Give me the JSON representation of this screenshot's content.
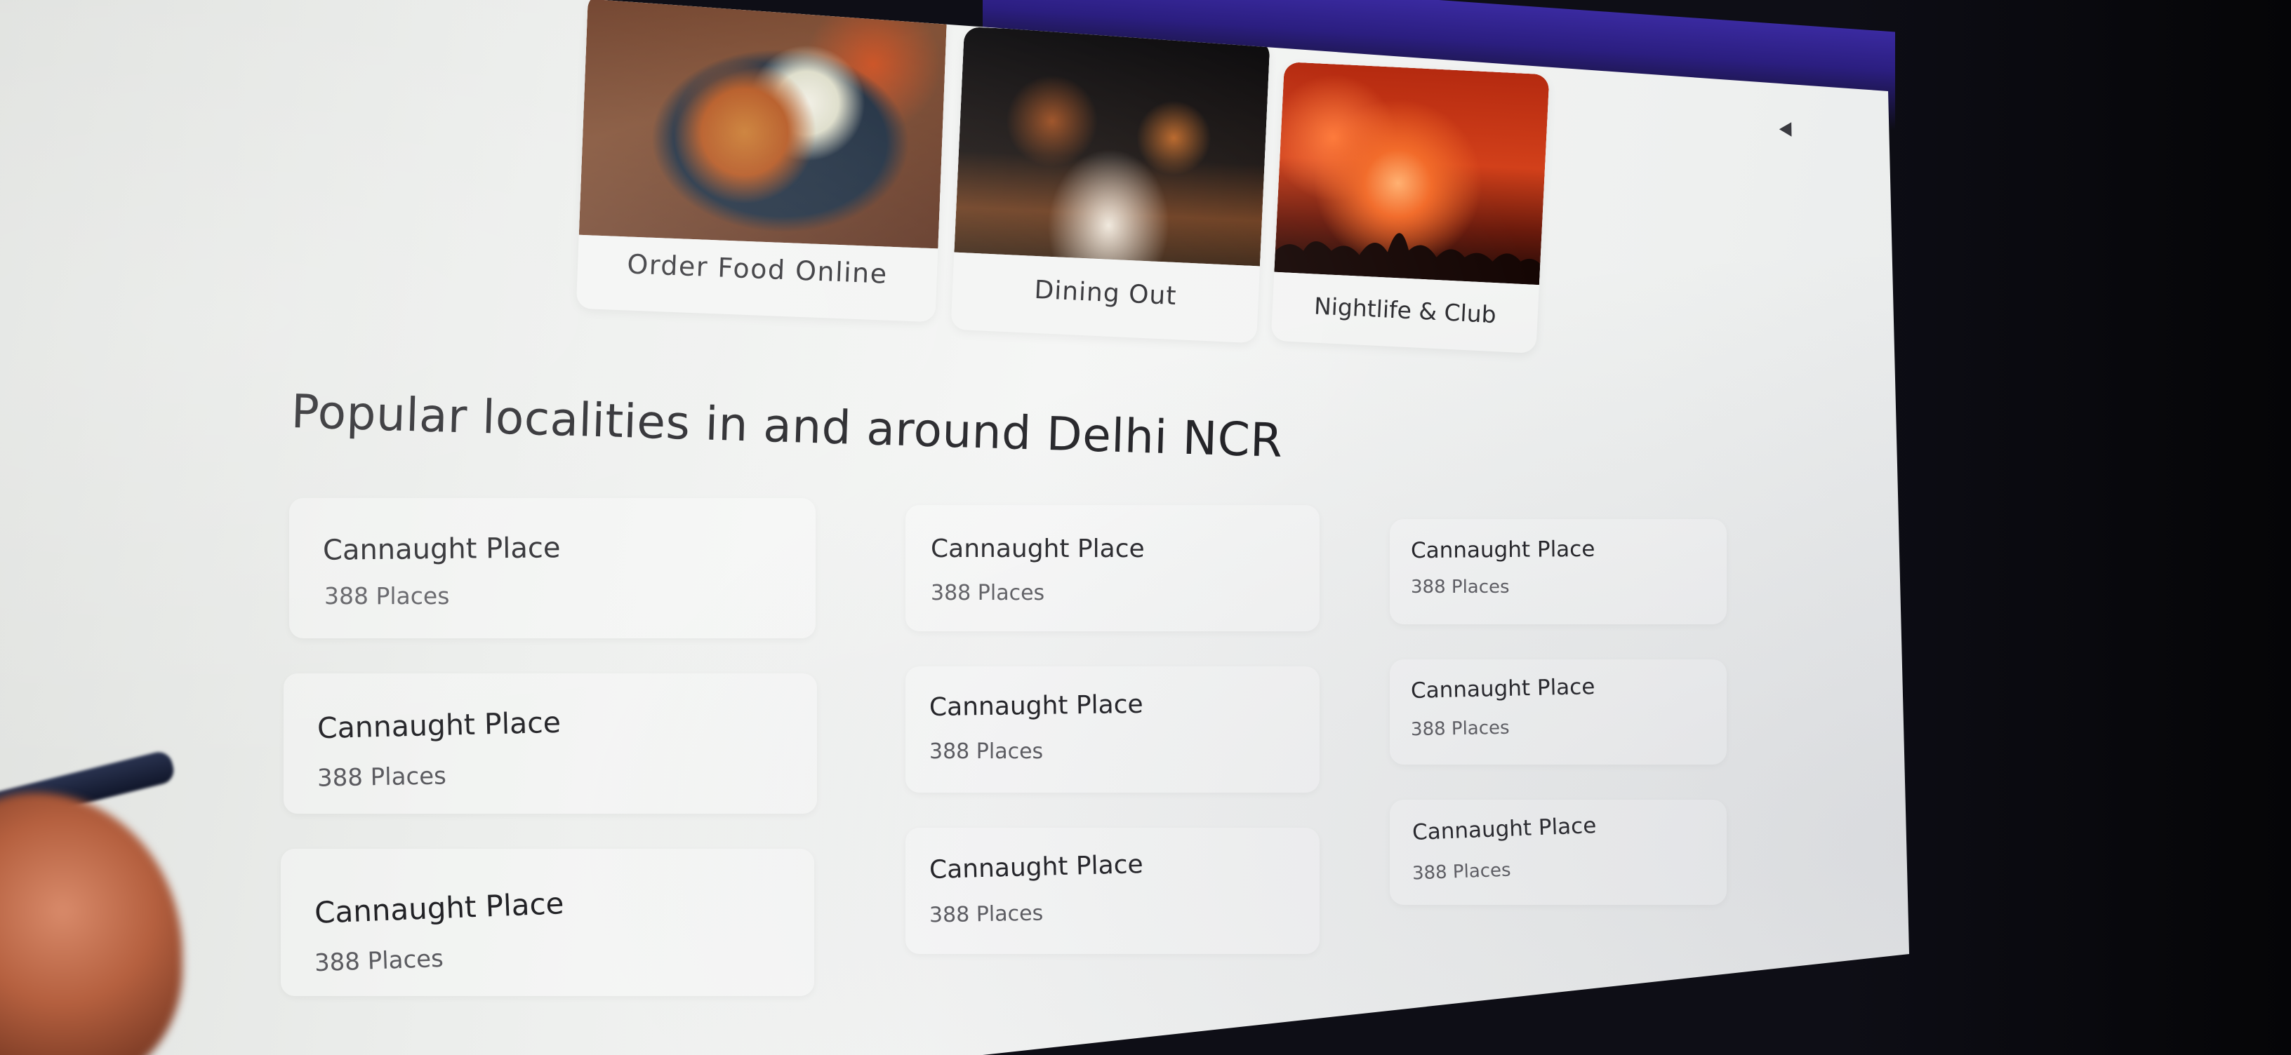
{
  "categories": [
    {
      "label": "Order Food Online",
      "icon": "food-plate-image"
    },
    {
      "label": "Dining Out",
      "icon": "restaurant-tables-image"
    },
    {
      "label": "Nightlife & Club",
      "icon": "club-crowd-image"
    }
  ],
  "section_title": "Popular localities in and around Delhi NCR",
  "localities": [
    {
      "name": "Cannaught Place",
      "count": "388 Places"
    },
    {
      "name": "Cannaught Place",
      "count": "388 Places"
    },
    {
      "name": "Cannaught Place",
      "count": "388 Places"
    },
    {
      "name": "Cannaught Place",
      "count": "388 Places"
    },
    {
      "name": "Cannaught Place",
      "count": "388 Places"
    },
    {
      "name": "Cannaught Place",
      "count": "388 Places"
    },
    {
      "name": "Cannaught Place",
      "count": "388 Places"
    },
    {
      "name": "Cannaught Place",
      "count": "388 Places"
    },
    {
      "name": "Cannaught Place",
      "count": "388 Places"
    }
  ],
  "colors": {
    "page_background": "#eef0ef",
    "title_text": "#17171b",
    "card_text": "#222226",
    "count_text": "#5b5b60",
    "bezel_glow": "#3a2aa0"
  }
}
